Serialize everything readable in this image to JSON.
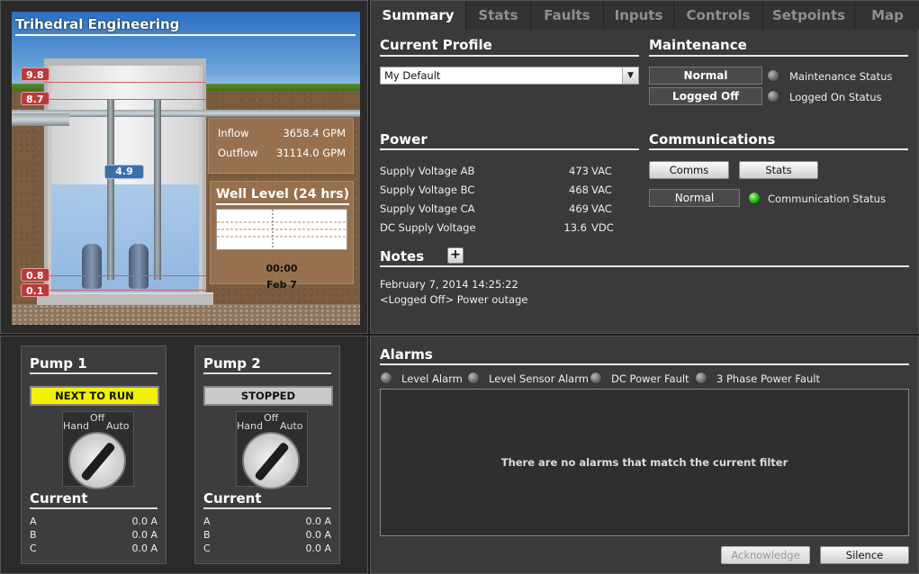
{
  "station": {
    "title": "Trihedral Engineering",
    "level_markers": [
      "9.8",
      "8.7",
      "0.8",
      "0.1"
    ],
    "current_level": "4.9",
    "inflow_label": "Inflow",
    "inflow_value": "3658.4 GPM",
    "outflow_label": "Outflow",
    "outflow_value": "31114.0 GPM",
    "well_level_title": "Well Level (24 hrs)",
    "chart_time": "00:00",
    "chart_date": "Feb 7"
  },
  "tabs": [
    "Summary",
    "Stats",
    "Faults",
    "Inputs",
    "Controls",
    "Setpoints",
    "Map"
  ],
  "current_profile": {
    "title": "Current Profile",
    "selected": "My Default"
  },
  "maintenance": {
    "title": "Maintenance",
    "status_value": "Normal",
    "status_label": "Maintenance Status",
    "logon_value": "Logged Off",
    "logon_label": "Logged On Status"
  },
  "power": {
    "title": "Power",
    "rows": [
      {
        "label": "Supply Voltage AB",
        "value": "473",
        "unit": "VAC"
      },
      {
        "label": "Supply Voltage BC",
        "value": "468",
        "unit": "VAC"
      },
      {
        "label": "Supply Voltage CA",
        "value": "469",
        "unit": "VAC"
      },
      {
        "label": "DC Supply Voltage",
        "value": "13.6",
        "unit": "VDC"
      }
    ]
  },
  "communications": {
    "title": "Communications",
    "comms_button": "Comms",
    "stats_button": "Stats",
    "status_value": "Normal",
    "status_label": "Communication Status"
  },
  "notes": {
    "title": "Notes",
    "add_icon": "plus-icon",
    "timestamp": "February 7, 2014 14:25:22",
    "text": "<Logged Off> Power outage"
  },
  "pumps": [
    {
      "title": "Pump 1",
      "state": "NEXT TO RUN",
      "state_color": "#f2f200",
      "off_label": "Off",
      "hand_label": "Hand",
      "auto_label": "Auto",
      "current_title": "Current",
      "currents": [
        {
          "phase": "A",
          "value": "0.0 A"
        },
        {
          "phase": "B",
          "value": "0.0 A"
        },
        {
          "phase": "C",
          "value": "0.0 A"
        }
      ]
    },
    {
      "title": "Pump 2",
      "state": "STOPPED",
      "state_color": "#c9c9c9",
      "off_label": "Off",
      "hand_label": "Hand",
      "auto_label": "Auto",
      "current_title": "Current",
      "currents": [
        {
          "phase": "A",
          "value": "0.0 A"
        },
        {
          "phase": "B",
          "value": "0.0 A"
        },
        {
          "phase": "C",
          "value": "0.0 A"
        }
      ]
    }
  ],
  "alarms": {
    "title": "Alarms",
    "filters": [
      "Level Alarm",
      "Level Sensor Alarm",
      "DC Power Fault",
      "3 Phase Power Fault"
    ],
    "empty_message": "There are no alarms that match the current filter",
    "acknowledge_button": "Acknowledge",
    "silence_button": "Silence"
  }
}
